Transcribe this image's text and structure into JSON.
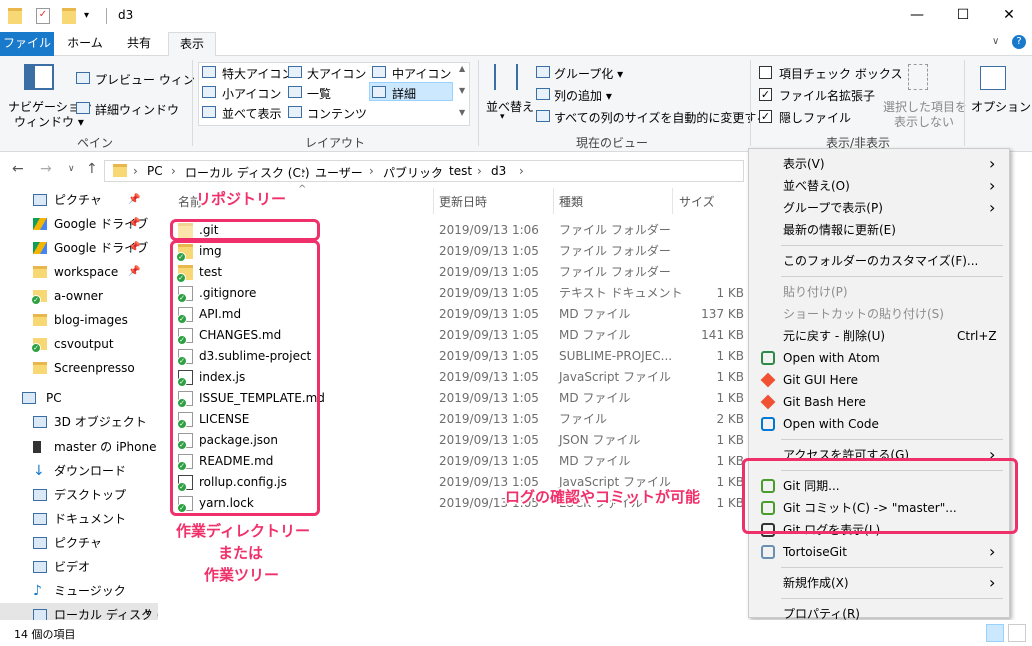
{
  "window": {
    "title": "d3",
    "minimize_glyph": "—",
    "maximize_glyph": "☐",
    "close_glyph": "✕",
    "help_glyph": "?",
    "collapse_glyph": "∨"
  },
  "tabs": [
    "ファイル",
    "ホーム",
    "共有",
    "表示"
  ],
  "ribbon": {
    "panes": {
      "nav_pane_line1": "ナビゲーション",
      "nav_pane_line2": "ウィンドウ ▾",
      "preview": "プレビュー ウィンドウ",
      "details": "詳細ウィンドウ",
      "label": "ペイン"
    },
    "layout": {
      "xl_icons": "特大アイコン",
      "large_icons": "大アイコン",
      "medium_icons": "中アイコン",
      "small_icons": "小アイコン",
      "list": "一覧",
      "details": "詳細",
      "tiles": "並べて表示",
      "content": "コンテンツ",
      "label": "レイアウト"
    },
    "current_view": {
      "sort_by": "並べ替え",
      "group_by": "グループ化 ▾",
      "add_columns": "列の追加 ▾",
      "size_all_columns": "すべての列のサイズを自動的に変更する",
      "label": "現在のビュー"
    },
    "show_hide": {
      "item_checkboxes": "項目チェック ボックス",
      "item_checkboxes_checked": false,
      "file_name_extensions": "ファイル名拡張子",
      "file_name_extensions_checked": true,
      "hidden_items": "隠しファイル",
      "hidden_items_checked": true,
      "hide_selected_line1": "選択した項目を",
      "hide_selected_line2": "表示しない",
      "label": "表示/非表示"
    },
    "options": "オプション"
  },
  "address": {
    "segments": [
      "PC",
      "ローカル ディスク (C:)",
      "ユーザー",
      "パブリック",
      "test",
      "d3"
    ],
    "separator": "›"
  },
  "nav": [
    {
      "label": "ピクチャ",
      "icon": "pictures-icon",
      "pinned": true
    },
    {
      "label": "Google ドライブ",
      "icon": "google-drive-icon",
      "pinned": true
    },
    {
      "label": "Google ドライブ",
      "icon": "google-drive-icon",
      "pinned": true
    },
    {
      "label": "workspace",
      "icon": "folder-icon",
      "pinned": true
    },
    {
      "label": "a-owner",
      "icon": "git-folder-icon",
      "pinned": false
    },
    {
      "label": "blog-images",
      "icon": "folder-icon",
      "pinned": false
    },
    {
      "label": "csvoutput",
      "icon": "git-folder-icon",
      "pinned": false
    },
    {
      "label": "Screenpresso",
      "icon": "folder-icon",
      "pinned": false
    },
    {
      "label": "PC",
      "icon": "pc-icon",
      "pinned": false
    },
    {
      "label": "3D オブジェクト",
      "icon": "3d-objects-icon",
      "pinned": false
    },
    {
      "label": "master の iPhone",
      "icon": "iphone-icon",
      "pinned": false
    },
    {
      "label": "ダウンロード",
      "icon": "download-icon",
      "pinned": false
    },
    {
      "label": "デスクトップ",
      "icon": "desktop-icon",
      "pinned": false
    },
    {
      "label": "ドキュメント",
      "icon": "documents-icon",
      "pinned": false
    },
    {
      "label": "ピクチャ",
      "icon": "pictures-icon",
      "pinned": false
    },
    {
      "label": "ビデオ",
      "icon": "videos-icon",
      "pinned": false
    },
    {
      "label": "ミュージック",
      "icon": "music-icon",
      "pinned": false
    },
    {
      "label": "ローカル ディスク (C",
      "icon": "local-disk-icon",
      "pinned": false
    }
  ],
  "columns": {
    "name": "名前",
    "date": "更新日時",
    "type": "種類",
    "size": "サイズ"
  },
  "files": [
    {
      "name": ".git",
      "date": "2019/09/13 1:06",
      "type": "ファイル フォルダー",
      "size": "",
      "icon": "folder-icon"
    },
    {
      "name": "img",
      "date": "2019/09/13 1:05",
      "type": "ファイル フォルダー",
      "size": "",
      "icon": "git-folder-icon"
    },
    {
      "name": "test",
      "date": "2019/09/13 1:05",
      "type": "ファイル フォルダー",
      "size": "",
      "icon": "git-folder-icon"
    },
    {
      "name": ".gitignore",
      "date": "2019/09/13 1:05",
      "type": "テキスト ドキュメント",
      "size": "1 KB",
      "icon": "git-file-icon"
    },
    {
      "name": "API.md",
      "date": "2019/09/13 1:05",
      "type": "MD ファイル",
      "size": "137 KB",
      "icon": "git-file-icon"
    },
    {
      "name": "CHANGES.md",
      "date": "2019/09/13 1:05",
      "type": "MD ファイル",
      "size": "141 KB",
      "icon": "git-file-icon"
    },
    {
      "name": "d3.sublime-project",
      "date": "2019/09/13 1:05",
      "type": "SUBLIME-PROJEC...",
      "size": "1 KB",
      "icon": "git-file-icon"
    },
    {
      "name": "index.js",
      "date": "2019/09/13 1:05",
      "type": "JavaScript ファイル",
      "size": "1 KB",
      "icon": "git-js-icon"
    },
    {
      "name": "ISSUE_TEMPLATE.md",
      "date": "2019/09/13 1:05",
      "type": "MD ファイル",
      "size": "1 KB",
      "icon": "git-file-icon"
    },
    {
      "name": "LICENSE",
      "date": "2019/09/13 1:05",
      "type": "ファイル",
      "size": "2 KB",
      "icon": "git-file-icon"
    },
    {
      "name": "package.json",
      "date": "2019/09/13 1:05",
      "type": "JSON ファイル",
      "size": "1 KB",
      "icon": "git-file-icon"
    },
    {
      "name": "README.md",
      "date": "2019/09/13 1:05",
      "type": "MD ファイル",
      "size": "1 KB",
      "icon": "git-file-icon"
    },
    {
      "name": "rollup.config.js",
      "date": "2019/09/13 1:05",
      "type": "JavaScript ファイル",
      "size": "1 KB",
      "icon": "git-js-icon"
    },
    {
      "name": "yarn.lock",
      "date": "2019/09/13 1:05",
      "type": "LOCK ファイル",
      "size": "1 KB",
      "icon": "git-file-icon"
    }
  ],
  "context_menu": [
    {
      "label": "表示(V)",
      "arrow": true
    },
    {
      "label": "並べ替え(O)",
      "arrow": true
    },
    {
      "label": "グループで表示(P)",
      "arrow": true
    },
    {
      "label": "最新の情報に更新(E)"
    },
    {
      "sep": true
    },
    {
      "label": "このフォルダーのカスタマイズ(F)..."
    },
    {
      "sep": true
    },
    {
      "label": "貼り付け(P)",
      "disabled": true
    },
    {
      "label": "ショートカットの貼り付け(S)",
      "disabled": true
    },
    {
      "label": "元に戻す - 削除(U)",
      "shortcut": "Ctrl+Z"
    },
    {
      "label": "Open with Atom",
      "icon": "atom-icon"
    },
    {
      "label": "Git GUI Here",
      "icon": "git-icon"
    },
    {
      "label": "Git Bash Here",
      "icon": "git-icon"
    },
    {
      "label": "Open with Code",
      "icon": "vscode-icon"
    },
    {
      "sep": true
    },
    {
      "label": "アクセスを許可する(G)",
      "arrow": true
    },
    {
      "sep": true
    },
    {
      "label": "Git 同期...",
      "icon": "tortoisegit-sync-icon"
    },
    {
      "label": "Git コミット(C) -> \"master\"...",
      "icon": "tortoisegit-commit-icon"
    },
    {
      "label": "Git ログを表示(L)",
      "icon": "tortoisegit-log-icon"
    },
    {
      "label": "TortoiseGit",
      "icon": "tortoisegit-icon",
      "arrow": true
    },
    {
      "sep": true
    },
    {
      "label": "新規作成(X)",
      "arrow": true
    },
    {
      "sep": true
    },
    {
      "label": "プロパティ(R)"
    }
  ],
  "annotations": {
    "repository": "リポジトリー",
    "working_dir_1": "作業ディレクトリー",
    "working_dir_2": "または",
    "working_dir_3": "作業ツリー",
    "log_commit": "ログの確認やコミットが可能"
  },
  "status": {
    "item_count": "14 個の項目"
  },
  "colors": {
    "accent": "#1979ca",
    "annotation": "#f0306a",
    "git_ok": "#2ea043"
  }
}
